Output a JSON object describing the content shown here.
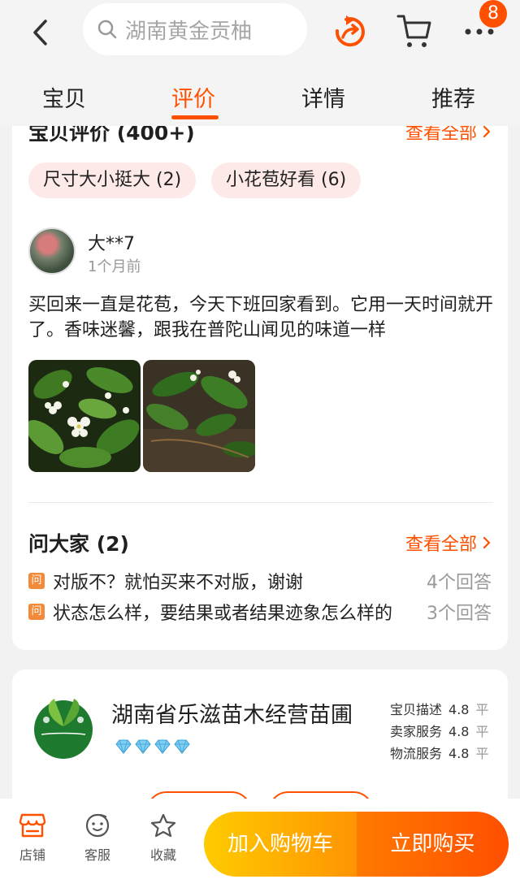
{
  "header": {
    "search_placeholder": "湖南黄金贡柚",
    "cart_badge": "8",
    "tabs": [
      {
        "label": "宝贝"
      },
      {
        "label": "评价"
      },
      {
        "label": "详情"
      },
      {
        "label": "推荐"
      }
    ],
    "active_tab": "评价"
  },
  "reviews": {
    "title": "宝贝评价 (400+)",
    "see_all": "查看全部",
    "tags": [
      {
        "label": "尺寸大小挺大 (2)"
      },
      {
        "label": "小花苞好看 (6)"
      }
    ],
    "item": {
      "user": "大**7",
      "time": "1个月前",
      "text": "买回来一直是花苞，今天下班回家看到。它用一天时间就开了。香味迷馨，跟我在普陀山闻见的味道一样"
    }
  },
  "qa": {
    "title": "问大家 (2)",
    "see_all": "查看全部",
    "icon_text": "问",
    "items": [
      {
        "question": "对版不？就怕买来不对版，谢谢",
        "answers": "4个回答"
      },
      {
        "question": "状态怎么样，要结果或者结果迹象怎么样的",
        "answers": "3个回答"
      }
    ]
  },
  "store": {
    "name": "湖南省乐滋苗木经营苗圃",
    "ratings": [
      {
        "label": "宝贝描述",
        "value": "4.8",
        "level": "平"
      },
      {
        "label": "卖家服务",
        "value": "4.8",
        "level": "平"
      },
      {
        "label": "物流服务",
        "value": "4.8",
        "level": "平"
      }
    ]
  },
  "bottom": {
    "store": "店铺",
    "service": "客服",
    "favorite": "收藏",
    "add_cart": "加入购物车",
    "buy_now": "立即购买"
  },
  "colors": {
    "accent": "#ff5000",
    "tag_bg": "#fde9e7"
  }
}
